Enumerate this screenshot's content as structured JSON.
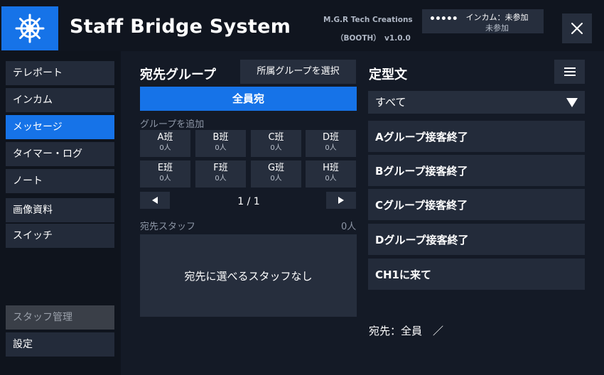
{
  "header": {
    "title": "Staff Bridge System",
    "credit_line1": "M.G.R Tech Creations",
    "credit_line2": "（BOOTH）　v1.0.0",
    "intercom_dots": "•••••",
    "intercom_label": "インカム：未参加",
    "intercom_status": "未参加",
    "logo_icon": "ship-wheel-icon",
    "close_icon": "close-icon"
  },
  "colors": {
    "accent": "#1673e8",
    "background": "#141a26",
    "panel": "#262e3d",
    "sidebar": "#0f141d"
  },
  "sidebar": {
    "items": [
      {
        "label": "テレポート"
      },
      {
        "label": "インカム"
      },
      {
        "label": "メッセージ"
      },
      {
        "label": "タイマー・ログ"
      },
      {
        "label": "ノート"
      },
      {
        "label": "画像資料"
      },
      {
        "label": "スイッチ"
      },
      {
        "label": "スタッフ管理"
      },
      {
        "label": "設定"
      }
    ],
    "active_index": 2
  },
  "recipients": {
    "title": "宛先グループ",
    "select_group_label": "所属グループを選択",
    "all_label": "全員宛",
    "add_group_label": "グループを追加",
    "groups": [
      {
        "name": "A班",
        "count": "0人"
      },
      {
        "name": "B班",
        "count": "0人"
      },
      {
        "name": "C班",
        "count": "0人"
      },
      {
        "name": "D班",
        "count": "0人"
      },
      {
        "name": "E班",
        "count": "0人"
      },
      {
        "name": "F班",
        "count": "0人"
      },
      {
        "name": "G班",
        "count": "0人"
      },
      {
        "name": "H班",
        "count": "0人"
      }
    ],
    "page": "1 / 1",
    "prev_icon": "triangle-left-icon",
    "next_icon": "triangle-right-icon",
    "staff_label": "宛先スタッフ",
    "staff_count": "0人",
    "staff_empty": "宛先に選べるスタッフなし"
  },
  "templates": {
    "title": "定型文",
    "menu_icon": "hamburger-menu-icon",
    "filter_value": "すべて",
    "items": [
      {
        "label": "Aグループ接客終了"
      },
      {
        "label": "Bグループ接客終了"
      },
      {
        "label": "Cグループ接客終了"
      },
      {
        "label": "Dグループ接客終了"
      },
      {
        "label": "CH1に来て"
      }
    ],
    "destination": "宛先：全員　／"
  }
}
